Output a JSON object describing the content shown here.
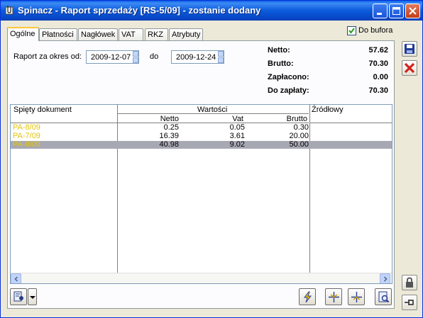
{
  "window": {
    "title": "Spinacz - Raport sprzedaży [RS-5/09]  - zostanie dodany"
  },
  "tabs": [
    {
      "label": "Ogólne",
      "active": true
    },
    {
      "label": "Płatności",
      "active": false
    },
    {
      "label": "Nagłówek",
      "active": false
    },
    {
      "label": "VAT",
      "active": false
    },
    {
      "label": "RKZ",
      "active": false
    },
    {
      "label": "Atrybuty",
      "active": false
    }
  ],
  "bufor": {
    "label": "Do bufora",
    "checked": true
  },
  "period": {
    "from_label": "Raport za okres od:",
    "from_value": "2009-12-07",
    "to_label": "do",
    "to_value": "2009-12-24"
  },
  "summary": {
    "netto_label": "Netto:",
    "netto_value": "57.62",
    "brutto_label": "Brutto:",
    "brutto_value": "70.30",
    "zaplacono_label": "Zapłacono:",
    "zaplacono_value": "0.00",
    "do_zaplaty_label": "Do zapłaty:",
    "do_zaplaty_value": "70.30"
  },
  "grid": {
    "col_doc": "Spięty dokument",
    "col_values": "Wartości",
    "col_source": "Źródłowy",
    "sub_netto": "Netto",
    "sub_vat": "Vat",
    "sub_brutto": "Brutto",
    "rows": [
      {
        "doc": "PA-8/09",
        "netto": "0.25",
        "vat": "0.05",
        "brutto": "0.30",
        "source": "",
        "selected": false
      },
      {
        "doc": "PA-7/09",
        "netto": "16.39",
        "vat": "3.61",
        "brutto": "20.00",
        "source": "",
        "selected": false
      },
      {
        "doc": "PA-8/09",
        "netto": "40.98",
        "vat": "9.02",
        "brutto": "50.00",
        "source": "",
        "selected": true
      }
    ]
  },
  "colors": {
    "doc_link": "#e3c600",
    "selected_row": "#a8a8b4",
    "title_bar": "#0b5bdb"
  },
  "icons": {
    "save": "save-icon",
    "cancel": "cancel-icon",
    "lock": "lock-icon",
    "pin": "pin-icon"
  }
}
